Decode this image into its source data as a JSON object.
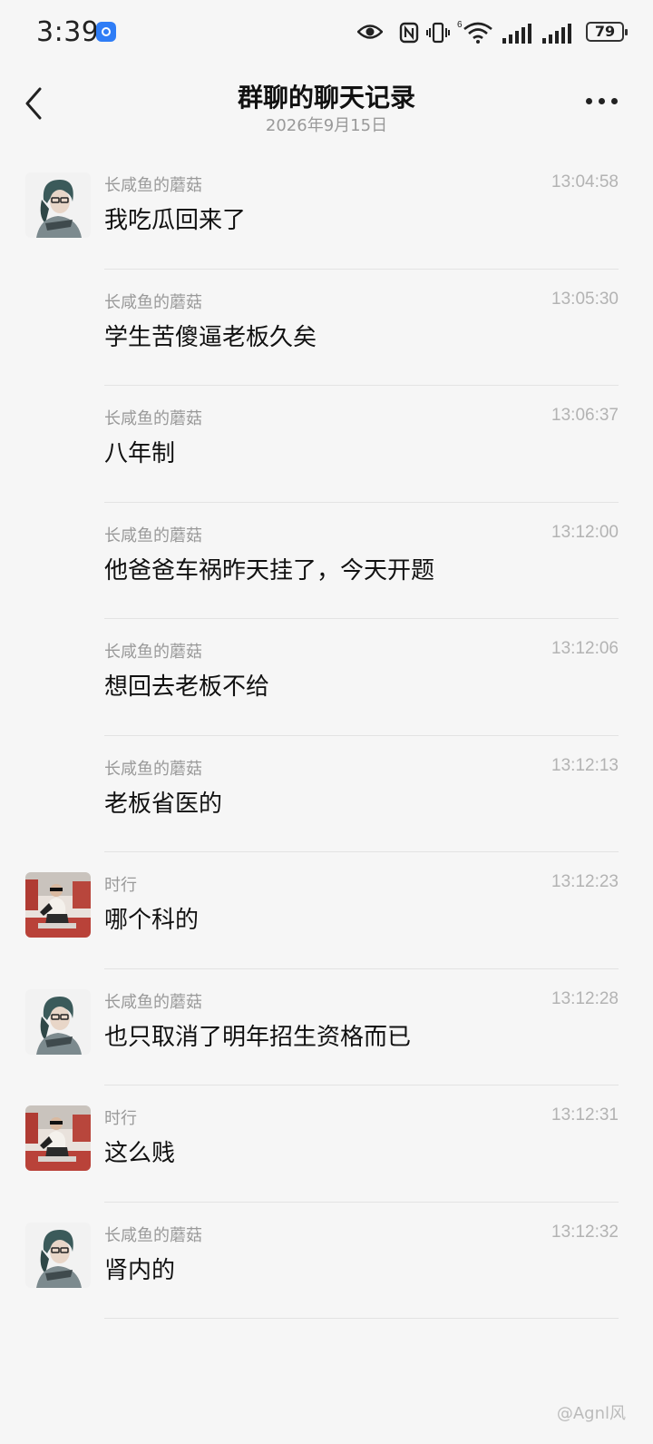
{
  "status_bar": {
    "time": "3:39",
    "battery": "79",
    "icons": [
      "app-notification-icon",
      "eye-icon",
      "nfc-icon",
      "vibrate-icon",
      "wifi-icon",
      "signal-icon",
      "signal-icon",
      "battery-icon"
    ]
  },
  "header": {
    "title": "群聊的聊天记录",
    "subtitle": "2026年9月15日",
    "back_icon": "chevron-left-icon",
    "more_icon": "more-icon"
  },
  "messages": [
    {
      "sender": "长咸鱼的蘑菇",
      "time": "13:04:58",
      "text": "我吃瓜回来了",
      "avatar": "avatar-a",
      "show_avatar": true
    },
    {
      "sender": "长咸鱼的蘑菇",
      "time": "13:05:30",
      "text": "学生苦傻逼老板久矣",
      "avatar": "avatar-a",
      "show_avatar": false
    },
    {
      "sender": "长咸鱼的蘑菇",
      "time": "13:06:37",
      "text": "八年制",
      "avatar": "avatar-a",
      "show_avatar": false
    },
    {
      "sender": "长咸鱼的蘑菇",
      "time": "13:12:00",
      "text": "他爸爸车祸昨天挂了，今天开题",
      "avatar": "avatar-a",
      "show_avatar": false
    },
    {
      "sender": "长咸鱼的蘑菇",
      "time": "13:12:06",
      "text": "想回去老板不给",
      "avatar": "avatar-a",
      "show_avatar": false
    },
    {
      "sender": "长咸鱼的蘑菇",
      "time": "13:12:13",
      "text": "老板省医的",
      "avatar": "avatar-a",
      "show_avatar": false
    },
    {
      "sender": "时行",
      "time": "13:12:23",
      "text": "哪个科的",
      "avatar": "avatar-b",
      "show_avatar": true
    },
    {
      "sender": "长咸鱼的蘑菇",
      "time": "13:12:28",
      "text": "也只取消了明年招生资格而已",
      "avatar": "avatar-a",
      "show_avatar": true
    },
    {
      "sender": "时行",
      "time": "13:12:31",
      "text": "这么贱",
      "avatar": "avatar-b",
      "show_avatar": true
    },
    {
      "sender": "长咸鱼的蘑菇",
      "time": "13:12:32",
      "text": "肾内的",
      "avatar": "avatar-a",
      "show_avatar": true
    }
  ],
  "watermark": "@Agnl风",
  "colors": {
    "background": "#f6f6f6",
    "sender": "#9a9a9a",
    "time": "#b3b3b3",
    "divider": "#e3e3e3"
  }
}
